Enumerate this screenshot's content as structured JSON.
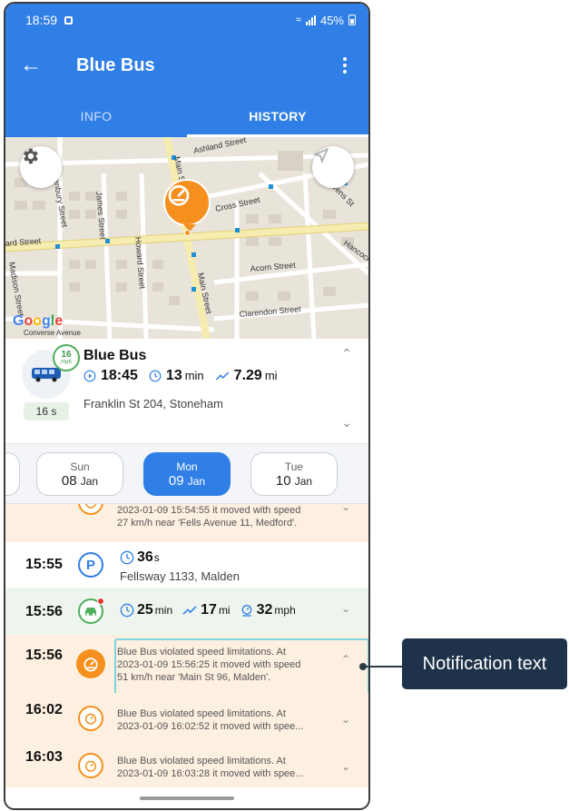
{
  "status_bar": {
    "time": "18:59",
    "battery": "45%"
  },
  "app_bar": {
    "title": "Blue Bus"
  },
  "tabs": [
    {
      "label": "INFO"
    },
    {
      "label": "HISTORY"
    }
  ],
  "map": {
    "streets": [
      "Ashland Street",
      "Cross Street",
      "Stevens St",
      "James Street",
      "Howard Street",
      "Main Street",
      "Main Street",
      "Acorn Street",
      "Clarendon Street",
      "Hancock",
      "Converse Avenue",
      "Madison Street",
      "Danbury Street",
      "ard Street"
    ],
    "google": [
      "G",
      "o",
      "o",
      "g",
      "l",
      "e"
    ]
  },
  "vehicle": {
    "name": "Blue Bus",
    "speed": "16",
    "speed_unit": "mph",
    "age": "16 s",
    "time": "18:45",
    "duration": "13",
    "duration_unit": "min",
    "distance": "7.29",
    "distance_unit": "mi",
    "address": "Franklin St 204, Stoneham"
  },
  "dates": [
    {
      "dow": "Sun",
      "day": "08",
      "month": "Jan"
    },
    {
      "dow": "Mon",
      "day": "09",
      "month": "Jan"
    },
    {
      "dow": "Tue",
      "day": "10",
      "month": "Jan"
    }
  ],
  "timeline": {
    "top_note": {
      "line1": "2023-01-09 15:54:55 it moved with speed",
      "line2": "27 km/h near 'Fells Avenue 11, Medford'."
    },
    "parking": {
      "time": "15:55",
      "letter": "P",
      "duration": "36",
      "duration_unit": "s",
      "address": "Fellsway 1133, Malden"
    },
    "moving": {
      "time": "15:56",
      "duration": "25",
      "duration_unit": "min",
      "distance": "17",
      "distance_unit": "mi",
      "max_speed": "32",
      "speed_unit": "mph"
    },
    "events": [
      {
        "time": "15:56",
        "line1": "Blue Bus violated speed limitations. At",
        "line2": "2023-01-09 15:56:25 it moved with speed",
        "line3": "51 km/h near 'Main St 96, Malden'."
      },
      {
        "time": "16:02",
        "line1": "Blue Bus violated speed limitations. At",
        "line2": "2023-01-09 16:02:52 it moved with spee..."
      },
      {
        "time": "16:03",
        "line1": "Blue Bus violated speed limitations. At",
        "line2": "2023-01-09 16:03:28 it moved with spee..."
      }
    ]
  },
  "callout": {
    "label": "Notification text"
  },
  "colors": {
    "primary": "#2f7fe6",
    "accent": "#f5901e",
    "success": "#4fae5b",
    "callout": "#1e3349",
    "highlight": "#7fd3de"
  }
}
